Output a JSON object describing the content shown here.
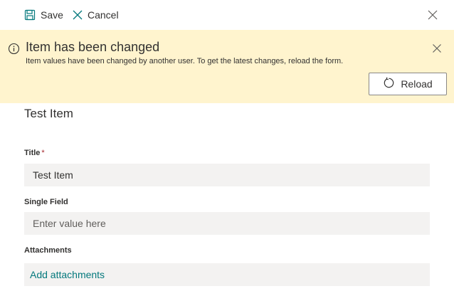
{
  "toolbar": {
    "save_label": "Save",
    "cancel_label": "Cancel"
  },
  "banner": {
    "title": "Item has been changed",
    "message": "Item values have been changed by another user. To get the latest changes, reload the form.",
    "reload_label": "Reload",
    "background": "#fff4ce"
  },
  "form": {
    "title": "Test Item",
    "fields": [
      {
        "label": "Title",
        "required_mark": "*",
        "value": "Test Item",
        "placeholder": ""
      },
      {
        "label": "Single Field",
        "value": "",
        "placeholder": "Enter value here"
      }
    ],
    "attachments": {
      "label": "Attachments",
      "link_label": "Add attachments"
    }
  },
  "icons": {
    "save": "save-icon",
    "cancel": "cancel-icon",
    "close_panel": "close-icon",
    "info": "info-icon",
    "banner_close": "close-icon",
    "reload": "refresh-icon"
  },
  "colors": {
    "accent": "#03787c",
    "required": "#a4262c",
    "field_bg": "#f3f2f1"
  }
}
